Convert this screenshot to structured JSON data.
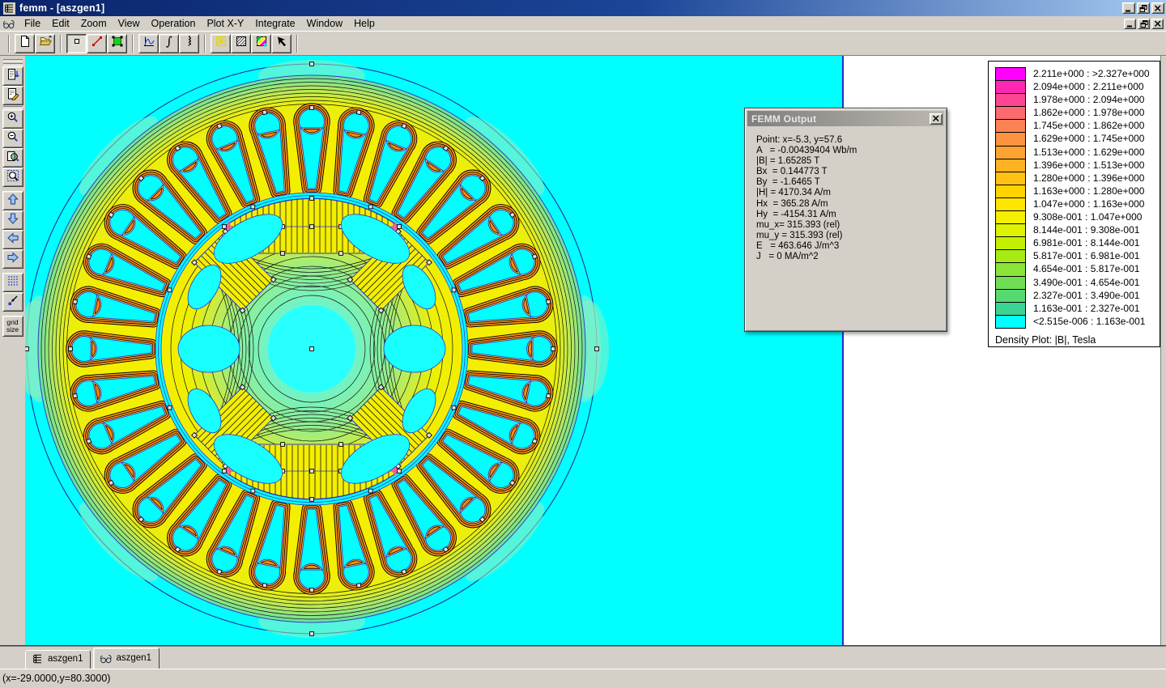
{
  "window": {
    "title": "femm - [aszgen1]"
  },
  "menu": {
    "items": [
      "File",
      "Edit",
      "Zoom",
      "View",
      "Operation",
      "Plot X-Y",
      "Integrate",
      "Window",
      "Help"
    ]
  },
  "toolbar": {
    "groups": [
      [
        {
          "name": "new-file",
          "icon": "new-file-icon"
        },
        {
          "name": "open-file",
          "icon": "open-folder-icon"
        }
      ],
      [
        {
          "name": "point-mode",
          "icon": "point-icon",
          "pressed": true
        },
        {
          "name": "line-mode",
          "icon": "line-icon"
        },
        {
          "name": "area-mode",
          "icon": "area-icon"
        }
      ],
      [
        {
          "name": "xy-plot",
          "icon": "curve-icon"
        },
        {
          "name": "line-integral",
          "icon": "integral-icon"
        },
        {
          "name": "block-integral",
          "icon": "squiggle-icon"
        }
      ],
      [
        {
          "name": "show-mesh",
          "icon": "mesh-icon"
        },
        {
          "name": "contour-plot",
          "icon": "hatch-icon"
        },
        {
          "name": "density-plot",
          "icon": "density-icon"
        },
        {
          "name": "show-vectors",
          "icon": "pointer-icon"
        }
      ]
    ]
  },
  "sidebar": {
    "groups": [
      [
        {
          "name": "point-values",
          "icon": "doc-arrow-icon"
        },
        {
          "name": "edit-values",
          "icon": "doc-pencil-icon"
        }
      ],
      [
        {
          "name": "zoom-in",
          "icon": "zoom-in-icon"
        },
        {
          "name": "zoom-out",
          "icon": "zoom-out-icon"
        },
        {
          "name": "zoom-extents",
          "icon": "zoom-page-icon"
        },
        {
          "name": "zoom-window",
          "icon": "zoom-window-icon"
        }
      ],
      [
        {
          "name": "pan-up",
          "icon": "arrow-up-icon"
        },
        {
          "name": "pan-down",
          "icon": "arrow-down-icon"
        },
        {
          "name": "pan-left",
          "icon": "arrow-left-icon"
        },
        {
          "name": "pan-right",
          "icon": "arrow-right-icon"
        }
      ],
      [
        {
          "name": "grid-toggle",
          "icon": "grid-dots-icon"
        },
        {
          "name": "snap-grid",
          "icon": "snap-icon"
        }
      ]
    ],
    "grid_size_label": "grid size"
  },
  "output_window": {
    "title": "FEMM Output",
    "lines": [
      "Point: x=-5.3, y=57.6",
      "A   = -0.00439404 Wb/m",
      "|B| = 1.65285 T",
      "Bx  = 0.144773 T",
      "By  = -1.6465 T",
      "|H| = 4170.34 A/m",
      "Hx  = 365.28 A/m",
      "Hy  = -4154.31 A/m",
      "mu_x= 315.393 (rel)",
      "mu_y = 315.393 (rel)",
      "E   = 463.646 J/m^3",
      "J   = 0 MA/m^2"
    ]
  },
  "legend": {
    "rows": [
      {
        "color": "#ff00ff",
        "label": "2.211e+000 : >2.327e+000"
      },
      {
        "color": "#ff28b4",
        "label": "2.094e+000 : 2.211e+000"
      },
      {
        "color": "#fc4692",
        "label": "1.978e+000 : 2.094e+000"
      },
      {
        "color": "#fa6a6e",
        "label": "1.862e+000 : 1.978e+000"
      },
      {
        "color": "#fb8254",
        "label": "1.745e+000 : 1.862e+000"
      },
      {
        "color": "#fb9340",
        "label": "1.629e+000 : 1.745e+000"
      },
      {
        "color": "#fda332",
        "label": "1.513e+000 : 1.629e+000"
      },
      {
        "color": "#feb224",
        "label": "1.396e+000 : 1.513e+000"
      },
      {
        "color": "#ffc114",
        "label": "1.280e+000 : 1.396e+000"
      },
      {
        "color": "#ffd200",
        "label": "1.163e+000 : 1.280e+000"
      },
      {
        "color": "#ffe600",
        "label": "1.047e+000 : 1.163e+000"
      },
      {
        "color": "#f4f000",
        "label": "9.308e-001 : 1.047e+000"
      },
      {
        "color": "#dcf200",
        "label": "8.144e-001 : 9.308e-001"
      },
      {
        "color": "#c2f000",
        "label": "6.981e-001 : 8.144e-001"
      },
      {
        "color": "#a6ec14",
        "label": "5.817e-001 : 6.981e-001"
      },
      {
        "color": "#8ae438",
        "label": "4.654e-001 : 5.817e-001"
      },
      {
        "color": "#70de55",
        "label": "3.490e-001 : 4.654e-001"
      },
      {
        "color": "#57d972",
        "label": "2.327e-001 : 3.490e-001"
      },
      {
        "color": "#3cd494",
        "label": "1.163e-001 : 2.327e-001"
      },
      {
        "color": "#00ffff",
        "label": "<2.515e-006 : 1.163e-001"
      }
    ],
    "footer": "Density Plot: |B|, Tesla"
  },
  "tabs": [
    {
      "label": "aszgen1",
      "icon": "coil-icon",
      "active": false
    },
    {
      "label": "aszgen1",
      "icon": "glasses-icon",
      "active": true
    }
  ],
  "status_bar": {
    "coordinates": "(x=-29.0000,y=80.3000)"
  },
  "colors": {
    "canvas": "#00ffff",
    "chrome": "#d4d0c8",
    "titlebar_start": "#0a246a",
    "titlebar_end": "#a6caf0"
  }
}
